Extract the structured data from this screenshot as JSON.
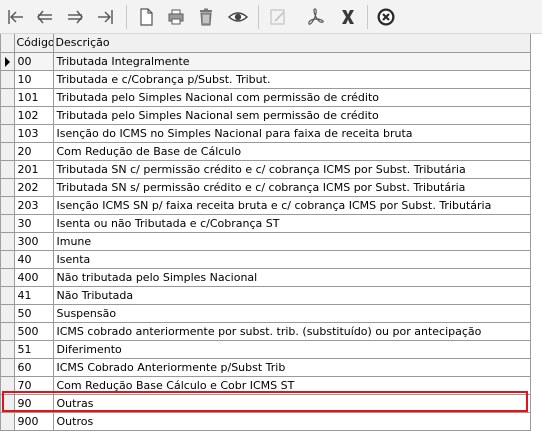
{
  "toolbar": {
    "buttons": [
      {
        "name": "first-record-button",
        "icon": "first-record-icon"
      },
      {
        "name": "previous-record-button",
        "icon": "previous-record-icon"
      },
      {
        "name": "next-record-button",
        "icon": "next-record-icon"
      },
      {
        "name": "last-record-button",
        "icon": "last-record-icon"
      },
      {
        "name": "new-document-button",
        "icon": "new-document-icon"
      },
      {
        "name": "print-button",
        "icon": "printer-icon"
      },
      {
        "name": "delete-button",
        "icon": "trash-icon"
      },
      {
        "name": "view-button",
        "icon": "eye-icon"
      },
      {
        "name": "edit-button",
        "icon": "edit-icon",
        "disabled": true
      },
      {
        "name": "pdf-export-button",
        "icon": "pdf-icon"
      },
      {
        "name": "excel-export-button",
        "icon": "excel-icon"
      },
      {
        "name": "close-button",
        "icon": "close-circle-icon"
      }
    ]
  },
  "grid": {
    "columns": [
      "Código",
      "Descrição"
    ],
    "rows": [
      {
        "codigo": "00",
        "descricao": "Tributada Integralmente"
      },
      {
        "codigo": "10",
        "descricao": "Tributada e c/Cobrança p/Subst. Tribut."
      },
      {
        "codigo": "101",
        "descricao": "Tributada pelo Simples Nacional com permissão de crédito"
      },
      {
        "codigo": "102",
        "descricao": "Tributada pelo Simples Nacional sem permissão de crédito"
      },
      {
        "codigo": "103",
        "descricao": "Isenção do ICMS no Simples Nacional para faixa de receita bruta"
      },
      {
        "codigo": "20",
        "descricao": "Com Redução de Base de Cálculo"
      },
      {
        "codigo": "201",
        "descricao": "Tributada SN c/ permissão crédito e c/ cobrança ICMS por Subst. Tributária"
      },
      {
        "codigo": "202",
        "descricao": "Tributada SN s/ permissão crédito e c/ cobrança ICMS por Subst. Tributária"
      },
      {
        "codigo": "203",
        "descricao": "Isenção ICMS SN p/ faixa receita bruta e c/ cobrança ICMS por Subst. Tributária"
      },
      {
        "codigo": "30",
        "descricao": "Isenta ou não Tributada e c/Cobrança ST"
      },
      {
        "codigo": "300",
        "descricao": "Imune"
      },
      {
        "codigo": "40",
        "descricao": "Isenta"
      },
      {
        "codigo": "400",
        "descricao": "Não tributada pelo Simples Nacional"
      },
      {
        "codigo": "41",
        "descricao": "Não Tributada"
      },
      {
        "codigo": "50",
        "descricao": "Suspensão"
      },
      {
        "codigo": "500",
        "descricao": "ICMS cobrado anteriormente por subst. trib. (substituído) ou por antecipação"
      },
      {
        "codigo": "51",
        "descricao": "Diferimento"
      },
      {
        "codigo": "60",
        "descricao": "ICMS Cobrado Anteriormente p/Subst Trib"
      },
      {
        "codigo": "70",
        "descricao": "Com Redução Base Cálculo e Cobr ICMS ST"
      },
      {
        "codigo": "90",
        "descricao": "Outras"
      },
      {
        "codigo": "900",
        "descricao": "Outros"
      }
    ],
    "current_row_index": 0,
    "highlighted_row_index": 19
  },
  "colors": {
    "highlight": "#e0141a",
    "toolbar_background": "#f3f3f3",
    "grid_lines": "#9a9a9a",
    "close_button": "#2a2a2a"
  }
}
